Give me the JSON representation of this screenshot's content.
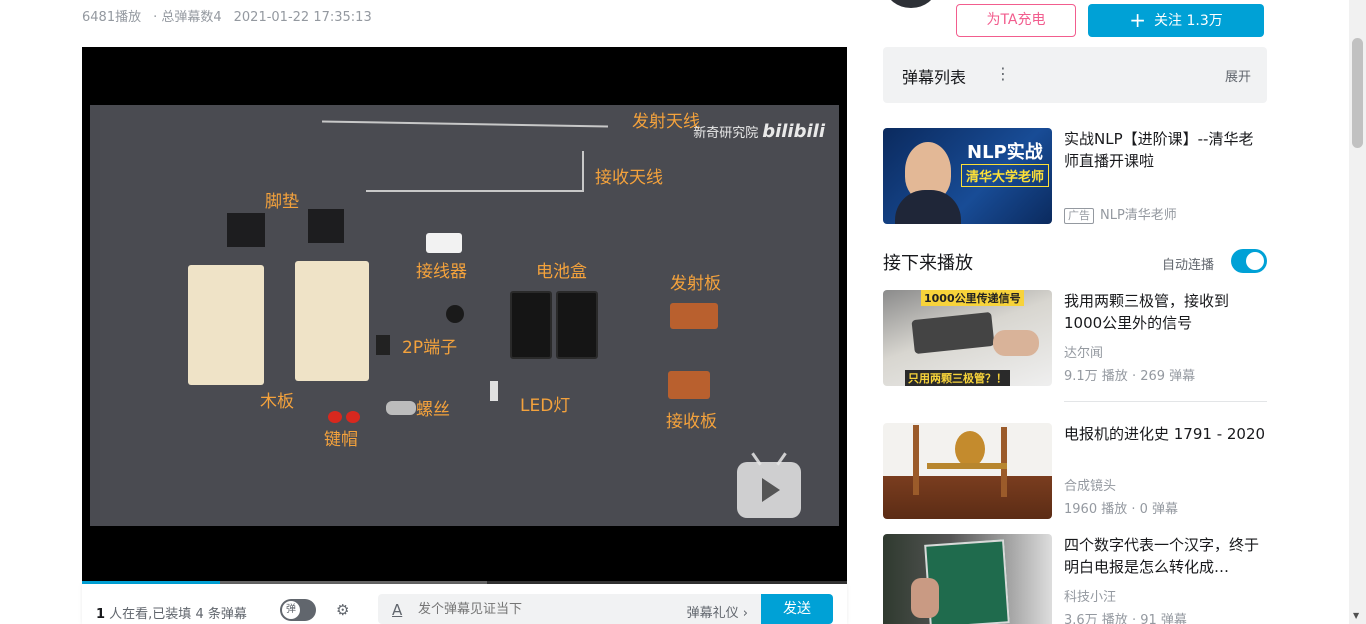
{
  "video_meta": {
    "views": "6481播放",
    "danmaku_total": "· 总弹幕数4",
    "published": "2021-01-22 17:35:13"
  },
  "video_frame": {
    "watermark_text": "新奇研究院",
    "watermark_logo": "bilibili",
    "labels": {
      "transmit_antenna": "发射天线",
      "receive_antenna": "接收天线",
      "foot_pad": "脚垫",
      "connector": "接线器",
      "battery_box": "电池盒",
      "transmit_board": "发射板",
      "terminal_2p": "2P端子",
      "wood_board": "木板",
      "screw": "螺丝",
      "led": "LED灯",
      "receive_board": "接收板",
      "keycap": "键帽"
    },
    "progress_played": 0.18,
    "progress_buffered": 0.53
  },
  "danmaku_bar": {
    "viewers_count": "1",
    "viewers_text": " 人在看,已装填 4 条弹幕",
    "toggle_label": "弹",
    "input_placeholder": "发个弹幕见证当下",
    "etiquette": "弹幕礼仪 ›",
    "send_label": "发送"
  },
  "uploader_actions": {
    "charge_label": "为TA充电",
    "follow_plus": "+",
    "follow_label": "关注 1.3万"
  },
  "danmaku_list": {
    "title": "弹幕列表",
    "menu_dots": "⋮",
    "expand_label": "展开"
  },
  "ad_card": {
    "title": "实战NLP【进阶课】--清华老师直播开课啦",
    "ad_tag": "广告",
    "uploader": "NLP清华老师",
    "thumb_line1": "NLP实战",
    "thumb_line2": "清华大学老师"
  },
  "up_next": {
    "title": "接下来播放",
    "autoplay_label": "自动连播",
    "autoplay_on": true
  },
  "recommendations": [
    {
      "title": "我用两颗三极管，接收到1000公里外的信号",
      "uploader": "达尔闻",
      "stats": "9.1万 播放 · 269 弹幕",
      "thumb_top": "1000公里传递信号",
      "thumb_bottom": "只用两颗三极管？！"
    },
    {
      "title": "电报机的进化史 1791 - 2020",
      "uploader": "合成镜头",
      "stats": "1960 播放 · 0 弹幕"
    },
    {
      "title": "四个数字代表一个汉字，终于明白电报是怎么转化成…",
      "uploader": "科技小汪",
      "stats": "3.6万 播放 · 91 弹幕"
    }
  ],
  "colors": {
    "accent": "#00a1d6",
    "pink": "#f25d8e",
    "label_orange": "#f4a23c"
  }
}
